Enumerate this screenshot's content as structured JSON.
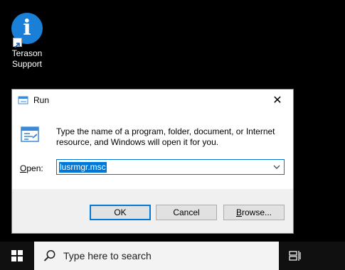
{
  "desktop": {
    "icons": [
      {
        "label_line1": "Terason",
        "label_line2": "Support",
        "icon": "info-icon",
        "color": "#1a7fd6"
      }
    ]
  },
  "dialog": {
    "title": "Run",
    "close_glyph": "✕",
    "description": "Type the name of a program, folder, document, or Internet resource, and Windows will open it for you.",
    "open_label_prefix": "",
    "open_label_underlined": "O",
    "open_label_rest": "pen:",
    "open_value": "lusrmgr.msc",
    "ok_label": "OK",
    "cancel_label": "Cancel",
    "browse_label_underlined": "B",
    "browse_label_rest": "rowse...",
    "accent": "#0078d7"
  },
  "taskbar": {
    "search_placeholder": "Type here to search",
    "start_icon": "windows-logo-icon",
    "taskview_icon": "task-view-icon"
  }
}
